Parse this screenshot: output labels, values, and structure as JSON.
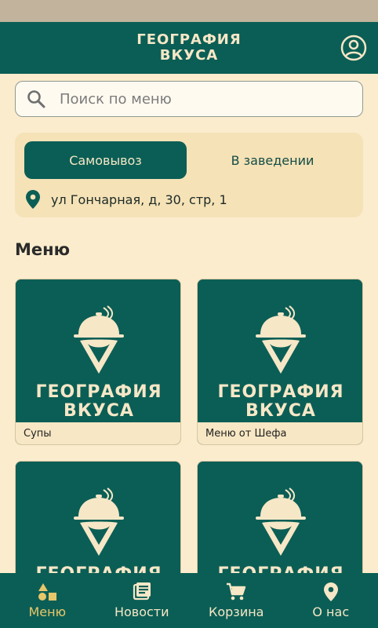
{
  "app": {
    "title_line1": "ГЕОГРАФИЯ",
    "title_line2": "ВКУСА"
  },
  "search": {
    "placeholder": "Поиск по меню",
    "value": ""
  },
  "order_mode": {
    "options": [
      "Самовывоз",
      "В заведении"
    ],
    "selected": "Самовывоз",
    "address": "ул Гончарная, д, 30, стр, 1"
  },
  "menu": {
    "title": "Меню",
    "brand_line1": "ГЕОГРАФИЯ",
    "brand_line2": "ВКУСА",
    "categories": [
      {
        "label": "Супы"
      },
      {
        "label": "Меню от Шефа"
      },
      {
        "label": ""
      },
      {
        "label": ""
      }
    ]
  },
  "bottom_nav": {
    "items": [
      {
        "label": "Меню",
        "icon": "shapes-icon",
        "active": true
      },
      {
        "label": "Новости",
        "icon": "newspaper-icon",
        "active": false
      },
      {
        "label": "Корзина",
        "icon": "cart-icon",
        "active": false
      },
      {
        "label": "О нас",
        "icon": "location-pin-icon",
        "active": false
      }
    ]
  },
  "colors": {
    "primary": "#0b5e55",
    "background": "#fbeccd",
    "card": "#f5e2b7",
    "accent": "#e8c66a",
    "text_light": "#f6e7c7"
  }
}
